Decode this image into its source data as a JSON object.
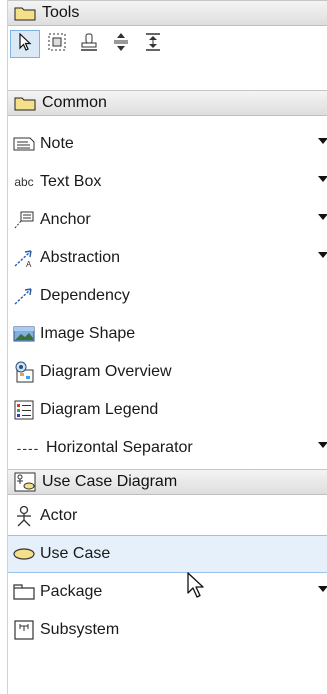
{
  "sections": {
    "tools": {
      "label": "Tools"
    },
    "common": {
      "label": "Common"
    },
    "use_case_diagram": {
      "label": "Use Case Diagram"
    }
  },
  "toolbar": {
    "tools": [
      {
        "name": "pointer-icon",
        "selected": true
      },
      {
        "name": "marquee-select-icon",
        "selected": false
      },
      {
        "name": "stamp-icon",
        "selected": false
      },
      {
        "name": "vertical-spacing-icon",
        "selected": false
      },
      {
        "name": "align-center-icon",
        "selected": false
      }
    ]
  },
  "common_items": [
    {
      "label": "Note",
      "icon": "note-icon",
      "has_dropdown": true
    },
    {
      "label": "Text Box",
      "icon": "abc",
      "has_dropdown": true
    },
    {
      "label": "Anchor",
      "icon": "anchor-icon",
      "has_dropdown": true
    },
    {
      "label": "Abstraction",
      "icon": "abstraction-icon",
      "has_dropdown": true
    },
    {
      "label": "Dependency",
      "icon": "dependency-icon",
      "has_dropdown": false
    },
    {
      "label": "Image Shape",
      "icon": "image-icon",
      "has_dropdown": false
    },
    {
      "label": "Diagram Overview",
      "icon": "diagram-overview-icon",
      "has_dropdown": false
    },
    {
      "label": "Diagram Legend",
      "icon": "legend-icon",
      "has_dropdown": false
    },
    {
      "label": "Horizontal Separator",
      "icon": "----",
      "has_dropdown": true
    }
  ],
  "usecase_items": [
    {
      "label": "Actor",
      "icon": "actor-icon",
      "has_dropdown": false
    },
    {
      "label": "Use Case",
      "icon": "use-case-icon",
      "has_dropdown": false,
      "selected": true
    },
    {
      "label": "Package",
      "icon": "package-icon",
      "has_dropdown": true
    },
    {
      "label": "Subsystem",
      "icon": "subsystem-icon",
      "has_dropdown": false
    }
  ],
  "colors": {
    "selection": "#e6f0fb",
    "header_bg": "#dedede",
    "folder_yellow": "#f5e08a"
  }
}
